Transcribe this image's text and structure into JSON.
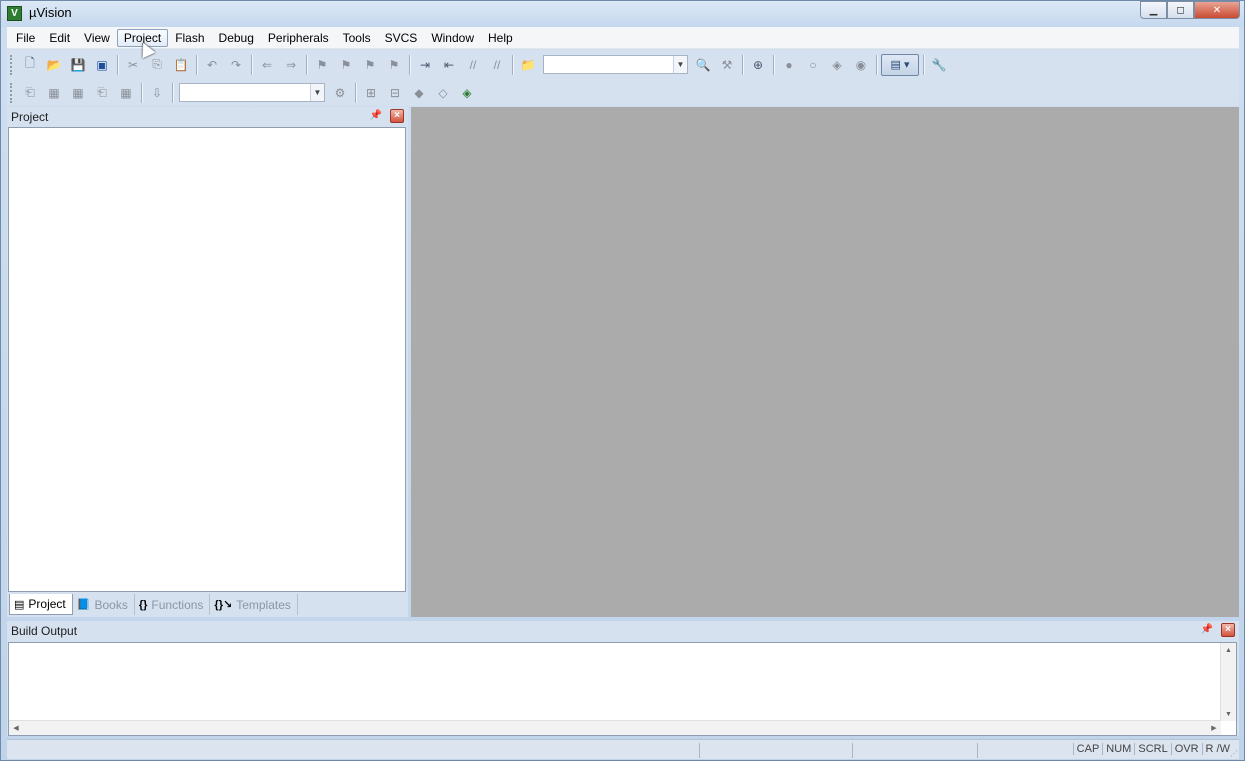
{
  "window": {
    "title": "µVision",
    "icon_letter": "V"
  },
  "menubar": {
    "items": [
      "File",
      "Edit",
      "View",
      "Project",
      "Flash",
      "Debug",
      "Peripherals",
      "Tools",
      "SVCS",
      "Window",
      "Help"
    ],
    "active": "Project"
  },
  "toolbar": {
    "find_combo_value": "",
    "target_combo_value": ""
  },
  "project_panel": {
    "title": "Project",
    "tabs": [
      {
        "label": "Project",
        "icon": "project-icon",
        "active": true
      },
      {
        "label": "Books",
        "icon": "books-icon",
        "active": false
      },
      {
        "label": "Functions",
        "icon": "functions-icon",
        "active": false
      },
      {
        "label": "Templates",
        "icon": "templates-icon",
        "active": false
      }
    ]
  },
  "build_panel": {
    "title": "Build Output"
  },
  "statusbar": {
    "indicators": [
      "CAP",
      "NUM",
      "SCRL",
      "OVR",
      "R /W"
    ]
  },
  "colors": {
    "editor_background": "#ababab",
    "chrome_background": "#d6e1ef",
    "close_button": "#d2533e"
  }
}
